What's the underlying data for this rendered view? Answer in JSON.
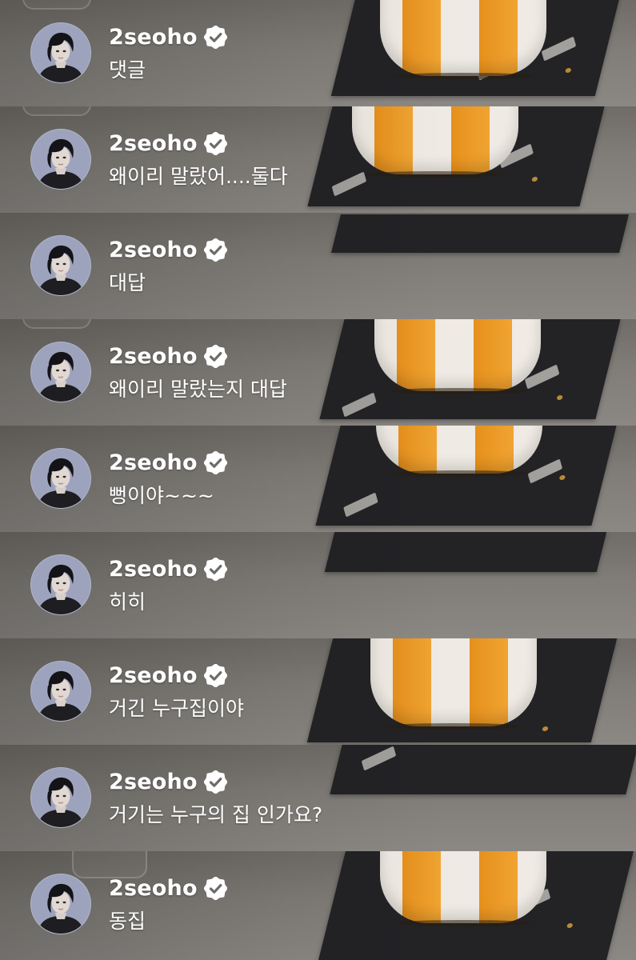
{
  "feed": {
    "comments": [
      {
        "username": "2seoho",
        "verified_icon": "verified-badge-icon",
        "text": "댓글"
      },
      {
        "username": "2seoho",
        "verified_icon": "verified-badge-icon",
        "text": "왜이리 말랐어....둘다"
      },
      {
        "username": "2seoho",
        "verified_icon": "verified-badge-icon",
        "text": "대답"
      },
      {
        "username": "2seoho",
        "verified_icon": "verified-badge-icon",
        "text": "왜이리 말랐는지 대답"
      },
      {
        "username": "2seoho",
        "verified_icon": "verified-badge-icon",
        "text": "뻥이야~~~"
      },
      {
        "username": "2seoho",
        "verified_icon": "verified-badge-icon",
        "text": "히히"
      },
      {
        "username": "2seoho",
        "verified_icon": "verified-badge-icon",
        "text": "거긴 누구집이야"
      },
      {
        "username": "2seoho",
        "verified_icon": "verified-badge-icon",
        "text": "거기는 누구의 집 인가요?"
      },
      {
        "username": "2seoho",
        "verified_icon": "verified-badge-icon",
        "text": "동집"
      }
    ]
  },
  "colors": {
    "text": "#ffffff",
    "tray": "#232326",
    "cake_orange": "#f0a432",
    "cake_cream": "#efeae3",
    "avatar_bg": "#9a9fb8"
  }
}
